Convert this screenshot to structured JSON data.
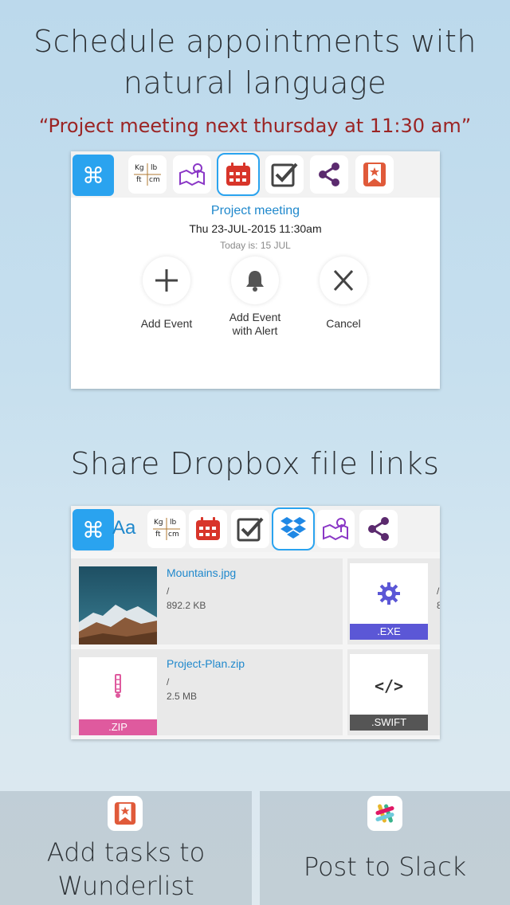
{
  "section1": {
    "headline_line1": "Schedule appointments with",
    "headline_line2": "natural language",
    "quote": "“Project meeting next thursday at 11:30 am”",
    "toolbar": {
      "command_glyph": "⌘",
      "converter": {
        "kg": "Kg",
        "lb": "lb",
        "ft": "ft",
        "cm": "cm"
      }
    },
    "event": {
      "title": "Project meeting",
      "datetime": "Thu 23-JUL-2015 11:30am",
      "today": "Today is: 15 JUL"
    },
    "actions": {
      "add_event": "Add Event",
      "add_event_alert_line1": "Add Event",
      "add_event_alert_line2": "with Alert",
      "cancel": "Cancel"
    }
  },
  "section2": {
    "headline": "Share Dropbox file links",
    "toolbar": {
      "command_glyph": "⌘",
      "font_glyph": "Aa",
      "converter": {
        "kg": "Kg",
        "lb": "lb",
        "ft": "ft",
        "cm": "cm"
      }
    },
    "files": [
      {
        "name": "Mountains.jpg",
        "path": "/",
        "size": "892.2 KB"
      },
      {
        "name": "Project-Plan.zip",
        "path": "/",
        "size": "2.5 MB",
        "ext": ".ZIP"
      }
    ],
    "tiles": [
      {
        "ext": ".EXE",
        "partial_path": "/",
        "partial_size": "8"
      },
      {
        "ext": ".SWIFT",
        "glyph": "</>"
      }
    ]
  },
  "bottom": {
    "left_line1": "Add tasks to",
    "left_line2": "Wunderlist",
    "right": "Post to Slack"
  },
  "colors": {
    "accent": "#2aa3ef",
    "link": "#1f88cc",
    "quote": "#9b2424",
    "exe_band": "#5b57d6",
    "zip_band": "#df5a9e",
    "swift_band": "#555555"
  }
}
